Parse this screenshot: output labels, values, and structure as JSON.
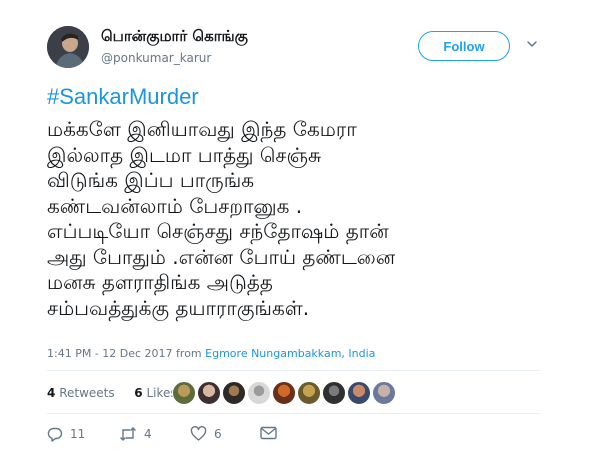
{
  "user": {
    "display_name": "பொன்குமார் கொங்கு",
    "handle": "@ponkumar_karur"
  },
  "follow_label": "Follow",
  "tweet": {
    "hashtag": "#SankarMurder",
    "lines": [
      "மக்களே இனியாவது இந்த கேமரா",
      "இல்லாத இடமா பாத்து செஞ்சு",
      "விடுங்க இப்ப பாருங்க",
      "கண்டவன்லாம் பேசறானுக .",
      "எப்படியோ செஞ்சது சந்தோஷம் தான்",
      "அது போதும் .என்ன போய் தண்டனை",
      "மனசு தளராதிங்க அடுத்த",
      "சம்பவத்துக்கு தயாராகுங்கள்."
    ]
  },
  "meta": {
    "time": "1:41 PM - 12 Dec 2017 from",
    "location": "Egmore Nungambakkam, India"
  },
  "stats": {
    "retweets_count": "4",
    "retweets_label": "Retweets",
    "likes_count": "6",
    "likes_label": "Likes"
  },
  "actions": {
    "replies": "11",
    "retweets": "4",
    "likes": "6"
  },
  "colors": {
    "accent": "#1da1f2",
    "link": "#1b95e0",
    "muted": "#657786",
    "text": "#14171a",
    "divider": "#e6ecf0"
  }
}
